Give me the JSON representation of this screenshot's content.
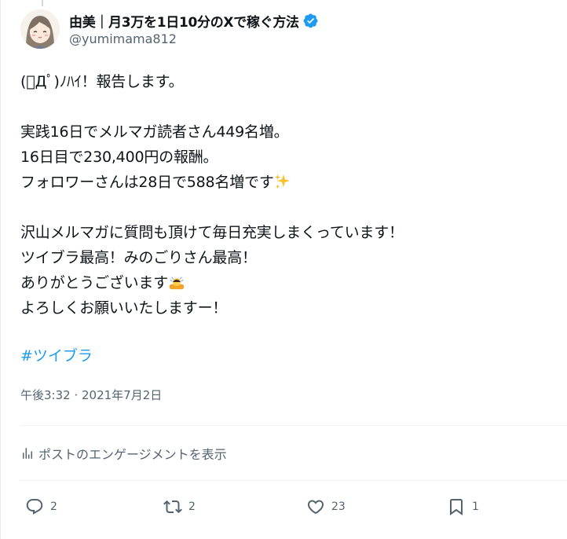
{
  "author": {
    "display_name": "由美｜月3万を1日10分のXで稼ぐ方法",
    "handle": "@yumimama812",
    "verified": true,
    "verified_color": "#1d9bf0"
  },
  "post": {
    "text": "(ﾟДﾟ)ﾉﾊｲ！報告します。\n\n実践16日でメルマガ読者さん449名増。\n16日目で230,400円の報酬。\nフォロワーさんは28日で588名増です",
    "text2": "\n\n沢山メルマガに質問も頂けて毎日充実しまくっています！\nツイブラ最高！みのごりさん最高！\nありがとうございます",
    "text3": "\nよろしくお願いいたしますー！",
    "emoji_sparkles": "sparkles-emoji",
    "emoji_bow": "person-bowing-emoji",
    "hashtag": "#ツイブラ",
    "hashtag_color": "#1d9bf0",
    "timestamp": "午後3:32 · 2021年7月2日"
  },
  "engagement_link": "ポストのエンゲージメントを表示",
  "actions": {
    "reply_count": "2",
    "repost_count": "2",
    "like_count": "23",
    "bookmark_count": "1"
  }
}
